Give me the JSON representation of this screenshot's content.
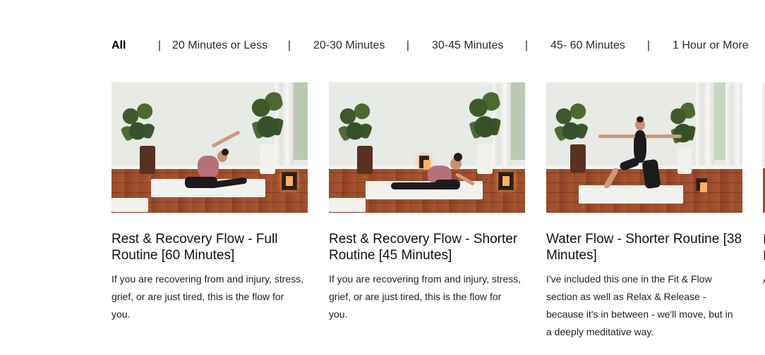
{
  "filters": {
    "items": [
      {
        "label": "All",
        "active": true
      },
      {
        "label": "20 Minutes or Less",
        "active": false
      },
      {
        "label": "20-30 Minutes",
        "active": false
      },
      {
        "label": "30-45 Minutes",
        "active": false
      },
      {
        "label": "45- 60 Minutes",
        "active": false
      },
      {
        "label": "1 Hour or More",
        "active": false
      }
    ],
    "separator": "|"
  },
  "cards": [
    {
      "title": "Rest & Recovery Flow - Full Routine [60 Minutes]",
      "description": "If you are recovering from and injury, stress, grief, or are just tired, this is the flow for you.",
      "thumbnail": "yoga-side-stretch-seated"
    },
    {
      "title": "Rest & Recovery Flow - Shorter Routine [45 Minutes]",
      "description": "If you are recovering from and injury, stress, grief, or are just tired, this is the flow for you.",
      "thumbnail": "yoga-pigeon-pose"
    },
    {
      "title": "Water Flow - Shorter Routine [38 Minutes]",
      "description": "I've included this one in the Fit & Flow section as well as Relax & Release - because it's in between - we'll move, but in a deeply meditative way.",
      "thumbnail": "yoga-warrior-two"
    }
  ],
  "partial_card": {
    "title_fragment": "I\nI",
    "desc_fragment": "A"
  },
  "colors": {
    "active_filter": "#000000",
    "text": "#1a1a1a",
    "floor": "#a0502e",
    "wall": "#e7eae5"
  }
}
